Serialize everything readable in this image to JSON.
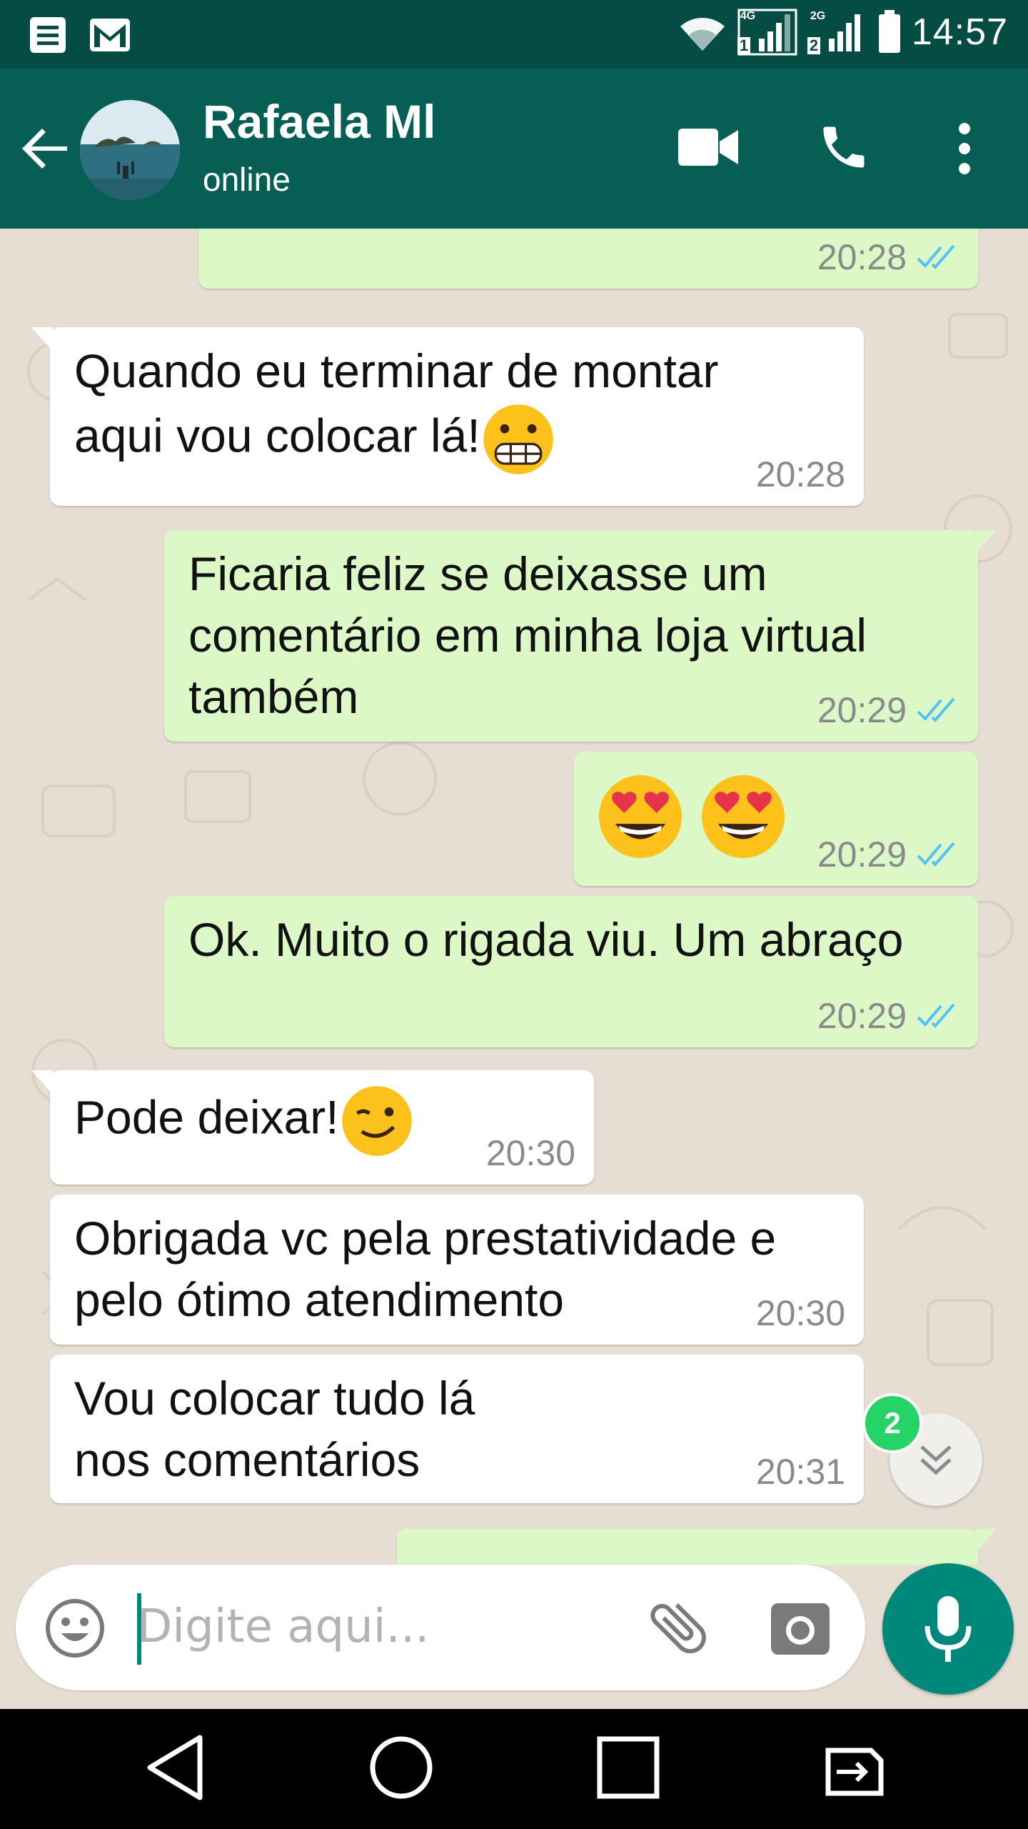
{
  "status_bar": {
    "time": "14:57",
    "network_1": "4G",
    "network_2": "2G",
    "sim_1": "1",
    "sim_2": "2"
  },
  "header": {
    "contact_name": "Rafaela Ml",
    "contact_status": "online"
  },
  "messages": [
    {
      "direction": "out",
      "text": "",
      "time": "20:28"
    },
    {
      "direction": "in",
      "line1": "Quando eu terminar de montar",
      "line2": "aqui vou colocar lá!",
      "emoji": "grimacing-face",
      "time": "20:28"
    },
    {
      "direction": "out",
      "text": "Ficaria feliz se deixasse um comentário em minha loja virtual também",
      "time": "20:29"
    },
    {
      "direction": "out",
      "emoji": [
        "heart-eyes-face",
        "heart-eyes-face"
      ],
      "time": "20:29"
    },
    {
      "direction": "out",
      "text": "Ok. Muito o rigada viu. Um abraço",
      "time": "20:29"
    },
    {
      "direction": "in",
      "text": "Pode deixar!",
      "emoji": "winking-smile-face",
      "time": "20:30"
    },
    {
      "direction": "in",
      "text": "Obrigada vc pela prestatividade e pelo ótimo atendimento",
      "time": "20:30"
    },
    {
      "direction": "in",
      "text": "Vou colocar tudo lá nos comentários",
      "time": "20:31"
    }
  ],
  "scroll_down": {
    "unread_count": "2"
  },
  "composer": {
    "placeholder": "Digite aqui..."
  },
  "colors": {
    "header": "#075e54",
    "statusbar": "#054d44",
    "outgoing_bubble": "#dcf8c6",
    "incoming_bubble": "#ffffff",
    "read_ticks": "#4fc3f7",
    "accent": "#00897b",
    "chat_bg": "#e6ddd3"
  },
  "icons": [
    "menu-notification-icon",
    "gmail-icon",
    "wifi-icon",
    "signal-icon",
    "battery-icon",
    "back-arrow-icon",
    "video-call-icon",
    "phone-icon",
    "more-vert-icon",
    "double-check-icon",
    "chevron-double-down-icon",
    "emoji-icon",
    "attach-icon",
    "camera-icon",
    "mic-icon",
    "nav-back-icon",
    "nav-home-icon",
    "nav-recents-icon",
    "nav-switch-sim-icon"
  ]
}
